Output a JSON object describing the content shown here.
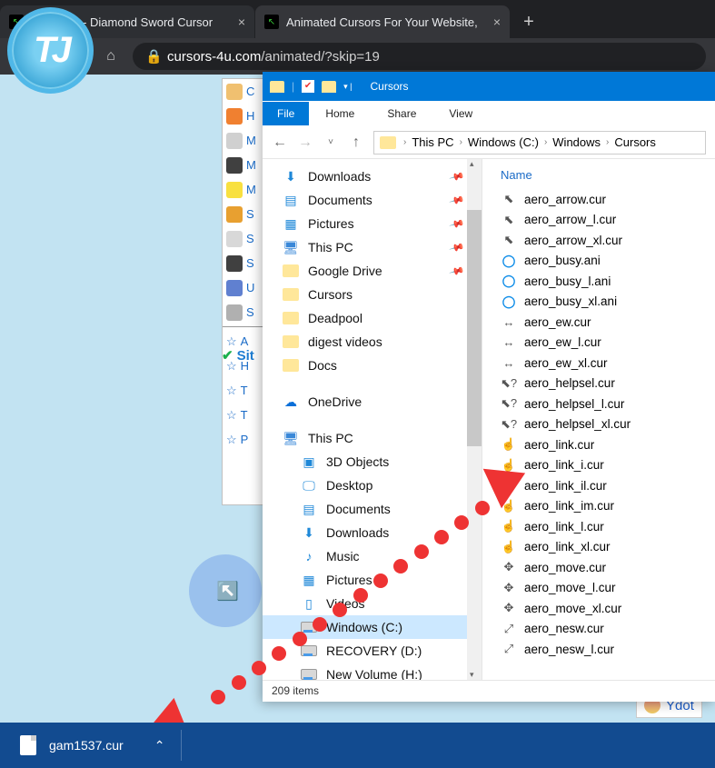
{
  "browser": {
    "tabs": [
      {
        "title": "Minecraft - Diamond Sword Cursor"
      },
      {
        "title": "Animated Cursors For Your Website,"
      }
    ],
    "url_host": "cursors-4u.com",
    "url_path": "/animated/?skip=19"
  },
  "sidebar_bg": {
    "items": [
      "C",
      "H",
      "M",
      "M",
      "M",
      "S",
      "S",
      "S",
      "U",
      "S"
    ],
    "site_label": "Sit",
    "fav_items": [
      "A",
      "H",
      "T",
      "T",
      "P"
    ],
    "bottom_link": "Ydot"
  },
  "explorer": {
    "window_title": "Cursors",
    "ribbon": {
      "file": "File",
      "tabs": [
        "Home",
        "Share",
        "View"
      ]
    },
    "breadcrumb": [
      "This PC",
      "Windows (C:)",
      "Windows",
      "Cursors"
    ],
    "nav": {
      "quick": [
        {
          "label": "Downloads",
          "icon": "download",
          "pin": true
        },
        {
          "label": "Documents",
          "icon": "doc",
          "pin": true
        },
        {
          "label": "Pictures",
          "icon": "pic",
          "pin": true
        },
        {
          "label": "This PC",
          "icon": "pc",
          "pin": true
        },
        {
          "label": "Google Drive",
          "icon": "folder",
          "pin": true
        },
        {
          "label": "Cursors",
          "icon": "folder"
        },
        {
          "label": "Deadpool",
          "icon": "folder"
        },
        {
          "label": "digest videos",
          "icon": "folder"
        },
        {
          "label": "Docs",
          "icon": "folder"
        }
      ],
      "onedrive": "OneDrive",
      "thispc": "This PC",
      "pc_items": [
        {
          "label": "3D Objects",
          "icon": "3d"
        },
        {
          "label": "Desktop",
          "icon": "desk"
        },
        {
          "label": "Documents",
          "icon": "doc"
        },
        {
          "label": "Downloads",
          "icon": "download"
        },
        {
          "label": "Music",
          "icon": "music"
        },
        {
          "label": "Pictures",
          "icon": "pic"
        },
        {
          "label": "Videos",
          "icon": "vid"
        },
        {
          "label": "Windows (C:)",
          "icon": "drive",
          "selected": true
        },
        {
          "label": "RECOVERY (D:)",
          "icon": "drive"
        },
        {
          "label": "New Volume (H:)",
          "icon": "drive"
        }
      ]
    },
    "column_header": "Name",
    "files": [
      {
        "icon": "⬉",
        "name": "aero_arrow.cur"
      },
      {
        "icon": "⬉",
        "name": "aero_arrow_l.cur"
      },
      {
        "icon": "⬉",
        "name": "aero_arrow_xl.cur"
      },
      {
        "icon": "◯",
        "name": "aero_busy.ani"
      },
      {
        "icon": "◯",
        "name": "aero_busy_l.ani"
      },
      {
        "icon": "◯",
        "name": "aero_busy_xl.ani"
      },
      {
        "icon": "↔",
        "name": "aero_ew.cur"
      },
      {
        "icon": "↔",
        "name": "aero_ew_l.cur"
      },
      {
        "icon": "↔",
        "name": "aero_ew_xl.cur"
      },
      {
        "icon": "⬉?",
        "name": "aero_helpsel.cur"
      },
      {
        "icon": "⬉?",
        "name": "aero_helpsel_l.cur"
      },
      {
        "icon": "⬉?",
        "name": "aero_helpsel_xl.cur"
      },
      {
        "icon": "☝",
        "name": "aero_link.cur"
      },
      {
        "icon": "☝",
        "name": "aero_link_i.cur"
      },
      {
        "icon": "☝",
        "name": "aero_link_il.cur"
      },
      {
        "icon": "☝",
        "name": "aero_link_im.cur"
      },
      {
        "icon": "☝",
        "name": "aero_link_l.cur"
      },
      {
        "icon": "☝",
        "name": "aero_link_xl.cur"
      },
      {
        "icon": "✥",
        "name": "aero_move.cur"
      },
      {
        "icon": "✥",
        "name": "aero_move_l.cur"
      },
      {
        "icon": "✥",
        "name": "aero_move_xl.cur"
      },
      {
        "icon": "⤢",
        "name": "aero_nesw.cur"
      },
      {
        "icon": "⤢",
        "name": "aero_nesw_l.cur"
      }
    ],
    "status": "209 items"
  },
  "download": {
    "filename": "gam1537.cur"
  },
  "logo_text": "TJ"
}
